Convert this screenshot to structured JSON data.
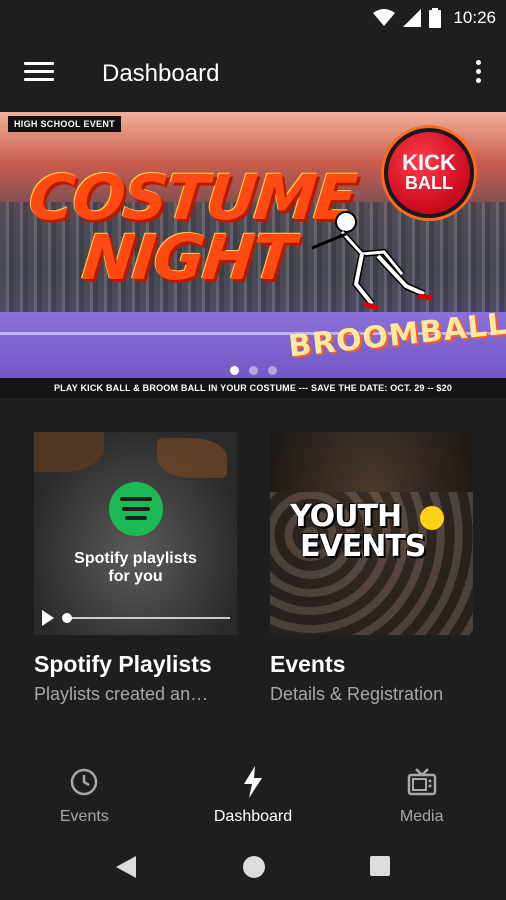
{
  "status_bar": {
    "time": "10:26"
  },
  "app_bar": {
    "title": "Dashboard",
    "menu_icon": "hamburger-menu-icon",
    "more_icon": "more-vert-icon"
  },
  "hero": {
    "tag": "HIGH SCHOOL EVENT",
    "title_line1": "COSTUME",
    "title_line2": "NIGHT",
    "logo_line1": "KICK",
    "logo_line2": "BALL",
    "subtitle": "BROOMBALL",
    "footer": "PLAY KICK BALL & BROOM BALL IN YOUR COSTUME  --- SAVE THE DATE: OCT. 29  -- $20",
    "pages": 3,
    "active_page": 1
  },
  "cards": [
    {
      "image_line1": "Spotify playlists",
      "image_line2": "for you",
      "title": "Spotify Playlists",
      "subtitle": "Playlists created an…"
    },
    {
      "image_line1": "YOUTH",
      "image_line2": "EVENTS",
      "title": "Events",
      "subtitle": "Details & Registration"
    }
  ],
  "bottom_nav": [
    {
      "label": "Events",
      "icon": "clock-icon",
      "active": false
    },
    {
      "label": "Dashboard",
      "icon": "lightning-bolt-icon",
      "active": true
    },
    {
      "label": "Media",
      "icon": "tv-icon",
      "active": false
    }
  ],
  "colors": {
    "background": "#1d1e20",
    "text": "#ffffff",
    "muted": "#a8a8a8",
    "spotify": "#1db954"
  }
}
